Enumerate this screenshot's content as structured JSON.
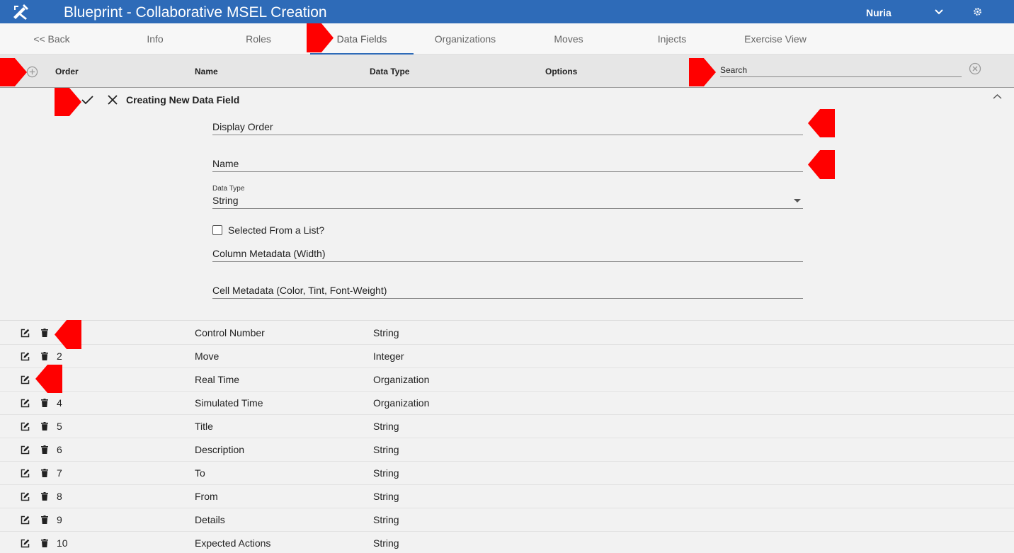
{
  "app": {
    "title": "Blueprint - Collaborative MSEL Creation",
    "user": "Nuria",
    "accent_color": "#2e6bb8"
  },
  "tabs": [
    {
      "label": "<< Back"
    },
    {
      "label": "Info"
    },
    {
      "label": "Roles"
    },
    {
      "label": "Data Fields",
      "active": true
    },
    {
      "label": "Organizations"
    },
    {
      "label": "Moves"
    },
    {
      "label": "Injects"
    },
    {
      "label": "Exercise View"
    }
  ],
  "header": {
    "order": "Order",
    "name": "Name",
    "data_type": "Data Type",
    "options": "Options",
    "search_placeholder": "Search"
  },
  "new_field": {
    "title": "Creating New Data Field",
    "display_order_placeholder": "Display Order",
    "name_placeholder": "Name",
    "data_type_label": "Data Type",
    "data_type_value": "String",
    "from_list_label": "Selected From a List?",
    "column_metadata_placeholder": "Column Metadata (Width)",
    "cell_metadata_placeholder": "Cell Metadata (Color, Tint, Font-Weight)"
  },
  "rows": [
    {
      "order": "",
      "name": "Control Number",
      "type": "String",
      "deletable": true
    },
    {
      "order": "2",
      "name": "Move",
      "type": "Integer",
      "deletable": true
    },
    {
      "order": "",
      "name": "Real Time",
      "type": "Organization",
      "deletable": false
    },
    {
      "order": "4",
      "name": "Simulated Time",
      "type": "Organization",
      "deletable": true
    },
    {
      "order": "5",
      "name": "Title",
      "type": "String",
      "deletable": true
    },
    {
      "order": "6",
      "name": "Description",
      "type": "String",
      "deletable": true
    },
    {
      "order": "7",
      "name": "To",
      "type": "String",
      "deletable": true
    },
    {
      "order": "8",
      "name": "From",
      "type": "String",
      "deletable": true
    },
    {
      "order": "9",
      "name": "Details",
      "type": "String",
      "deletable": true
    },
    {
      "order": "10",
      "name": "Expected Actions",
      "type": "String",
      "deletable": true
    }
  ]
}
